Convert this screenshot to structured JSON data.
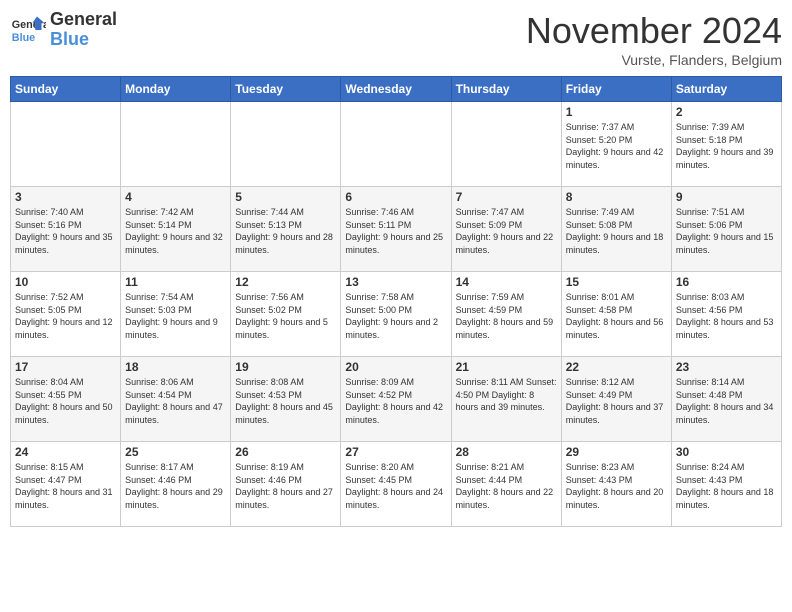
{
  "header": {
    "logo_text_general": "General",
    "logo_text_blue": "Blue",
    "month_title": "November 2024",
    "location": "Vurste, Flanders, Belgium"
  },
  "days_of_week": [
    "Sunday",
    "Monday",
    "Tuesday",
    "Wednesday",
    "Thursday",
    "Friday",
    "Saturday"
  ],
  "weeks": [
    [
      {
        "day": "",
        "info": ""
      },
      {
        "day": "",
        "info": ""
      },
      {
        "day": "",
        "info": ""
      },
      {
        "day": "",
        "info": ""
      },
      {
        "day": "",
        "info": ""
      },
      {
        "day": "1",
        "info": "Sunrise: 7:37 AM\nSunset: 5:20 PM\nDaylight: 9 hours and 42 minutes."
      },
      {
        "day": "2",
        "info": "Sunrise: 7:39 AM\nSunset: 5:18 PM\nDaylight: 9 hours and 39 minutes."
      }
    ],
    [
      {
        "day": "3",
        "info": "Sunrise: 7:40 AM\nSunset: 5:16 PM\nDaylight: 9 hours and 35 minutes."
      },
      {
        "day": "4",
        "info": "Sunrise: 7:42 AM\nSunset: 5:14 PM\nDaylight: 9 hours and 32 minutes."
      },
      {
        "day": "5",
        "info": "Sunrise: 7:44 AM\nSunset: 5:13 PM\nDaylight: 9 hours and 28 minutes."
      },
      {
        "day": "6",
        "info": "Sunrise: 7:46 AM\nSunset: 5:11 PM\nDaylight: 9 hours and 25 minutes."
      },
      {
        "day": "7",
        "info": "Sunrise: 7:47 AM\nSunset: 5:09 PM\nDaylight: 9 hours and 22 minutes."
      },
      {
        "day": "8",
        "info": "Sunrise: 7:49 AM\nSunset: 5:08 PM\nDaylight: 9 hours and 18 minutes."
      },
      {
        "day": "9",
        "info": "Sunrise: 7:51 AM\nSunset: 5:06 PM\nDaylight: 9 hours and 15 minutes."
      }
    ],
    [
      {
        "day": "10",
        "info": "Sunrise: 7:52 AM\nSunset: 5:05 PM\nDaylight: 9 hours and 12 minutes."
      },
      {
        "day": "11",
        "info": "Sunrise: 7:54 AM\nSunset: 5:03 PM\nDaylight: 9 hours and 9 minutes."
      },
      {
        "day": "12",
        "info": "Sunrise: 7:56 AM\nSunset: 5:02 PM\nDaylight: 9 hours and 5 minutes."
      },
      {
        "day": "13",
        "info": "Sunrise: 7:58 AM\nSunset: 5:00 PM\nDaylight: 9 hours and 2 minutes."
      },
      {
        "day": "14",
        "info": "Sunrise: 7:59 AM\nSunset: 4:59 PM\nDaylight: 8 hours and 59 minutes."
      },
      {
        "day": "15",
        "info": "Sunrise: 8:01 AM\nSunset: 4:58 PM\nDaylight: 8 hours and 56 minutes."
      },
      {
        "day": "16",
        "info": "Sunrise: 8:03 AM\nSunset: 4:56 PM\nDaylight: 8 hours and 53 minutes."
      }
    ],
    [
      {
        "day": "17",
        "info": "Sunrise: 8:04 AM\nSunset: 4:55 PM\nDaylight: 8 hours and 50 minutes."
      },
      {
        "day": "18",
        "info": "Sunrise: 8:06 AM\nSunset: 4:54 PM\nDaylight: 8 hours and 47 minutes."
      },
      {
        "day": "19",
        "info": "Sunrise: 8:08 AM\nSunset: 4:53 PM\nDaylight: 8 hours and 45 minutes."
      },
      {
        "day": "20",
        "info": "Sunrise: 8:09 AM\nSunset: 4:52 PM\nDaylight: 8 hours and 42 minutes."
      },
      {
        "day": "21",
        "info": "Sunrise: 8:11 AM\nSunset: 4:50 PM\nDaylight: 8 hours and 39 minutes."
      },
      {
        "day": "22",
        "info": "Sunrise: 8:12 AM\nSunset: 4:49 PM\nDaylight: 8 hours and 37 minutes."
      },
      {
        "day": "23",
        "info": "Sunrise: 8:14 AM\nSunset: 4:48 PM\nDaylight: 8 hours and 34 minutes."
      }
    ],
    [
      {
        "day": "24",
        "info": "Sunrise: 8:15 AM\nSunset: 4:47 PM\nDaylight: 8 hours and 31 minutes."
      },
      {
        "day": "25",
        "info": "Sunrise: 8:17 AM\nSunset: 4:46 PM\nDaylight: 8 hours and 29 minutes."
      },
      {
        "day": "26",
        "info": "Sunrise: 8:19 AM\nSunset: 4:46 PM\nDaylight: 8 hours and 27 minutes."
      },
      {
        "day": "27",
        "info": "Sunrise: 8:20 AM\nSunset: 4:45 PM\nDaylight: 8 hours and 24 minutes."
      },
      {
        "day": "28",
        "info": "Sunrise: 8:21 AM\nSunset: 4:44 PM\nDaylight: 8 hours and 22 minutes."
      },
      {
        "day": "29",
        "info": "Sunrise: 8:23 AM\nSunset: 4:43 PM\nDaylight: 8 hours and 20 minutes."
      },
      {
        "day": "30",
        "info": "Sunrise: 8:24 AM\nSunset: 4:43 PM\nDaylight: 8 hours and 18 minutes."
      }
    ]
  ]
}
